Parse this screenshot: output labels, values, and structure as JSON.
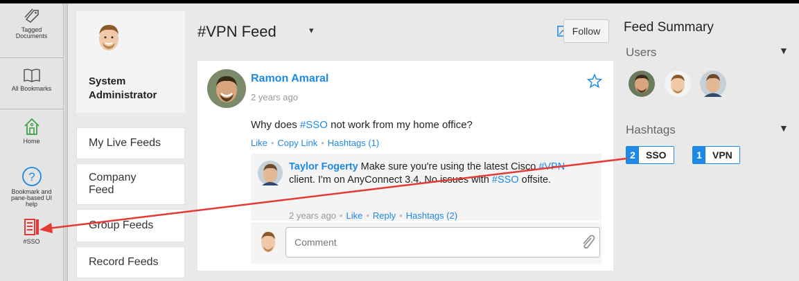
{
  "rail": {
    "items": [
      {
        "label_line1": "Tagged",
        "label_line2": "Documents",
        "icon": "tag-icon"
      },
      {
        "label_line1": "All Bookmarks",
        "label_line2": "",
        "icon": "book-icon"
      },
      {
        "label_line1": "Home",
        "label_line2": "",
        "icon": "home-icon"
      },
      {
        "label_line1": "Bookmark and",
        "label_line2": "pane-based UI",
        "label_line3": "help",
        "icon": "help-icon"
      },
      {
        "label_line1": "#SSO",
        "label_line2": "",
        "icon": "feed-icon"
      }
    ]
  },
  "profile": {
    "name_line1": "System",
    "name_line2": "Administrator"
  },
  "nav": {
    "items": [
      {
        "line1": "My Live Feeds",
        "line2": ""
      },
      {
        "line1": "Company",
        "line2": "Feed"
      },
      {
        "line1": "Group Feeds",
        "line2": ""
      },
      {
        "line1": "Record Feeds",
        "line2": ""
      }
    ]
  },
  "feed": {
    "title": "#VPN Feed",
    "caret": "▾",
    "follow_label": "Follow"
  },
  "post": {
    "author": "Ramon Amaral",
    "time": "2 years ago",
    "text_pre": "Why does ",
    "text_tag": "#SSO",
    "text_post": " not work from my home office?",
    "actions": {
      "like": "Like",
      "copy_link": "Copy Link",
      "hashtags": "Hashtags (1)"
    },
    "reply": {
      "author": "Taylor Fogerty",
      "text1": " Make sure you're using the latest Cisco ",
      "tag1": "#VPN",
      "text2": " client. I'm on AnyConnect 3.4. No issues with ",
      "tag2": "#SSO",
      "text3": " offsite.",
      "time": "2 years ago",
      "like": "Like",
      "reply": "Reply",
      "hashtags": "Hashtags (2)"
    },
    "comment_placeholder": "Comment"
  },
  "summary": {
    "title": "Feed Summary",
    "users_label": "Users",
    "hashtags_label": "Hashtags",
    "tags": [
      {
        "count": "2",
        "label": "SSO"
      },
      {
        "count": "1",
        "label": "VPN"
      }
    ]
  },
  "colors": {
    "accent": "#1e88e5",
    "annotation": "#e53935",
    "home": "#43a047"
  }
}
